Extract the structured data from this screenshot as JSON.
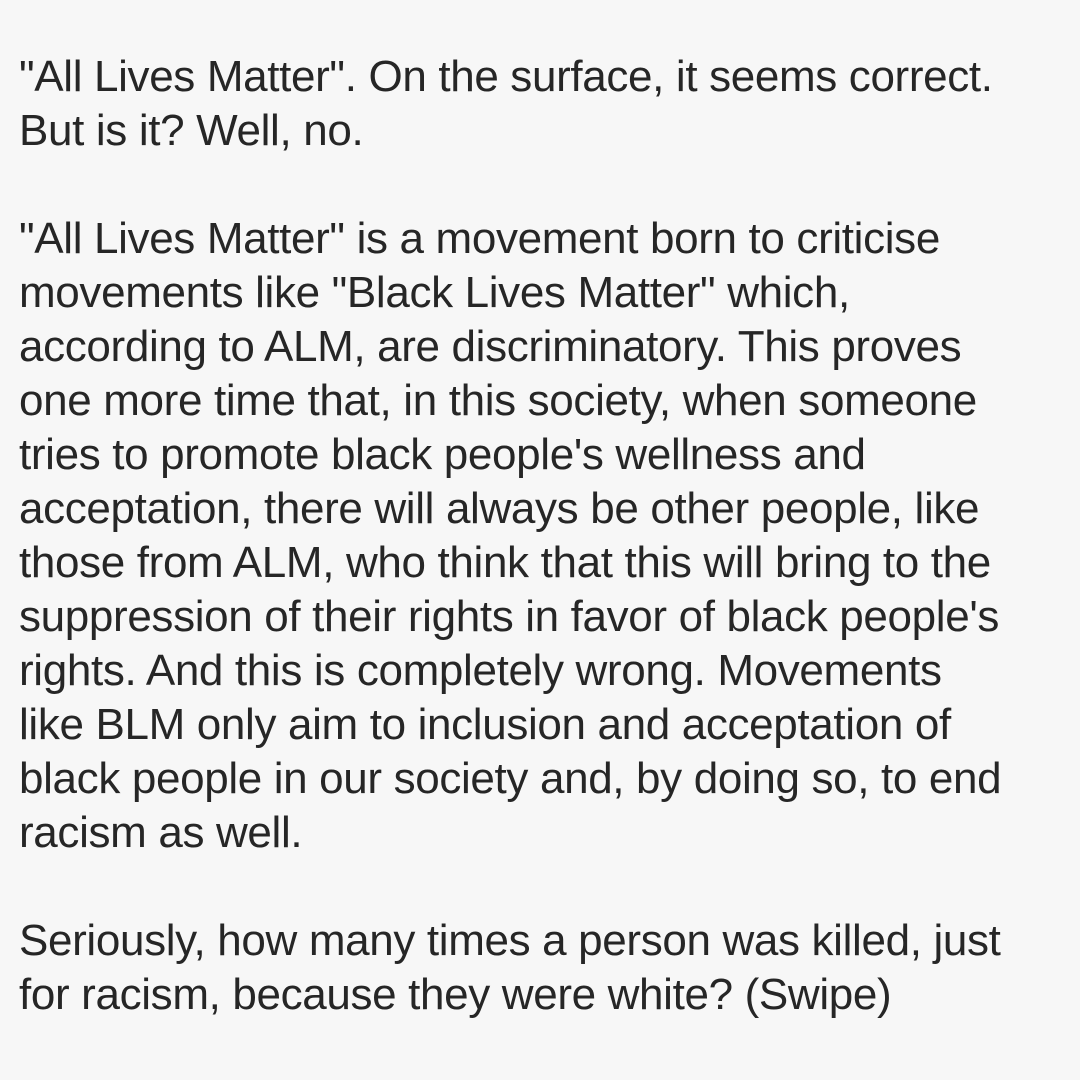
{
  "paragraphs": [
    {
      "lines": [
        "\"All Lives Matter\". On the surface, it seems correct.",
        "But is it? Well, no."
      ]
    },
    {
      "lines": [
        "\"All Lives Matter\" is a movement born to criticise",
        "movements like \"Black Lives Matter\" which,",
        "according to ALM, are discriminatory. This proves",
        "one more time that, in this society, when someone",
        "tries to promote black people's wellness and",
        "acceptation, there will always be other people, like",
        "those from ALM, who think that this will bring to the",
        "suppression of their rights in favor of black people's",
        "rights. And this is completely wrong. Movements",
        "like BLM only aim to inclusion and acceptation of",
        "black people in our society and, by doing so, to end",
        "racism as well."
      ]
    },
    {
      "lines": [
        "Seriously, how many times a person was killed, just",
        "for racism, because they were white? (Swipe)"
      ]
    }
  ]
}
